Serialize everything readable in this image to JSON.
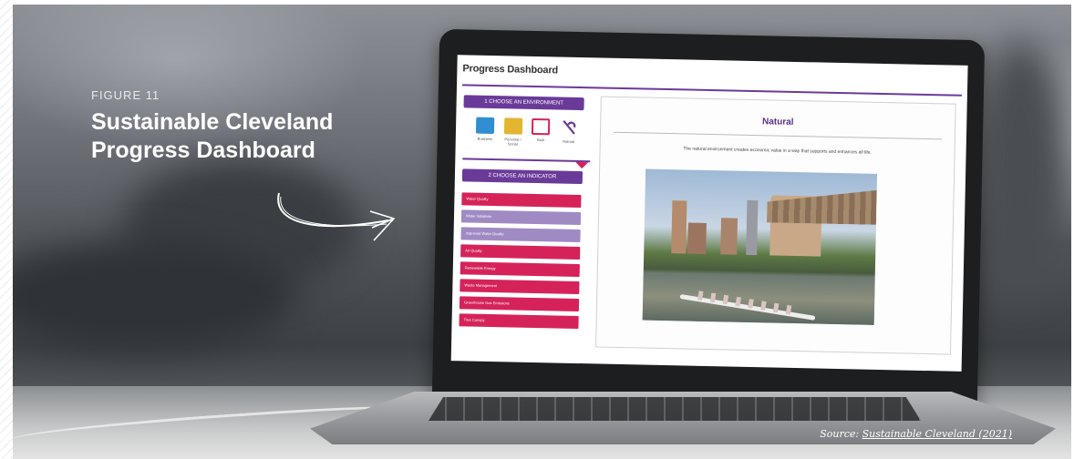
{
  "figure": {
    "label": "FIGURE 11",
    "title": "Sustainable Cleveland Progress Dashboard"
  },
  "dashboard": {
    "app_title": "Progress Dashboard",
    "step1_label": "1 CHOOSE AN ENVIRONMENT",
    "environments": [
      {
        "label": "Business",
        "icon": "briefcase-icon",
        "color": "#2f8fd1"
      },
      {
        "label": "Personal / Social",
        "icon": "document-icon",
        "color": "#e3b531"
      },
      {
        "label": "Built",
        "icon": "building-icon",
        "color": "#d6225a"
      },
      {
        "label": "Natural",
        "icon": "leaf-icon",
        "color": "#6a3a99"
      }
    ],
    "step2_label": "2 CHOOSE AN INDICATOR",
    "indicators": [
      {
        "label": "Water Quality",
        "style": "red"
      },
      {
        "label": "Water Initiatives",
        "style": "lav"
      },
      {
        "label": "Improved Water Quality",
        "style": "lav"
      },
      {
        "label": "Air Quality",
        "style": "red"
      },
      {
        "label": "Renewable Energy",
        "style": "red"
      },
      {
        "label": "Waste Management",
        "style": "red"
      },
      {
        "label": "Greenhouse Gas Emissions",
        "style": "red"
      },
      {
        "label": "Tree Canopy",
        "style": "red"
      }
    ],
    "panel_title": "Natural",
    "panel_description": "The natural environment creates economic value in a way that supports and enhances all life."
  },
  "source": {
    "prefix": "Source: ",
    "link_text": "Sustainable Cleveland (2021)"
  },
  "colors": {
    "accent_purple": "#6a3a99",
    "indicator_red": "#d5235a",
    "indicator_lavender": "#a08ac4"
  }
}
